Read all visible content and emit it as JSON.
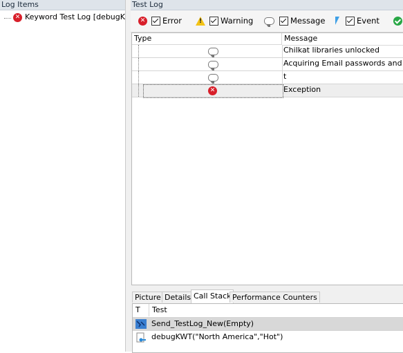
{
  "left_panel": {
    "title": "Log Items",
    "tree_item_label": "Keyword Test Log [debugK..."
  },
  "right_panel": {
    "title": "Test Log",
    "toolbar": {
      "error_label": "Error",
      "warning_label": "Warning",
      "message_label": "Message",
      "event_label": "Event"
    },
    "grid": {
      "col_type": "Type",
      "col_message": "Message",
      "rows": [
        {
          "icon": "message-icon",
          "message": "Chilkat libraries unlocked"
        },
        {
          "icon": "message-icon",
          "message": "Acquiring Email passwords and applic"
        },
        {
          "icon": "message-icon",
          "message": "t"
        },
        {
          "icon": "error-icon",
          "message": "Exception"
        }
      ]
    },
    "tabs": [
      "Picture",
      "Details",
      "Call Stack",
      "Performance Counters"
    ],
    "active_tab": "Call Stack",
    "call_stack": {
      "col_t": "T",
      "col_test": "Test",
      "rows": [
        {
          "icon": "script-icon",
          "text": "Send_TestLog_New(Empty)"
        },
        {
          "icon": "keyword-test-icon",
          "text": "debugKWT(\"North America\",\"Hot\")"
        }
      ]
    }
  },
  "colors": {
    "header_bg": "#dee4ea",
    "error_red": "#d81f2a",
    "warning_yellow": "#f3c316",
    "event_blue": "#3fa0e6",
    "ok_green": "#28a745"
  }
}
